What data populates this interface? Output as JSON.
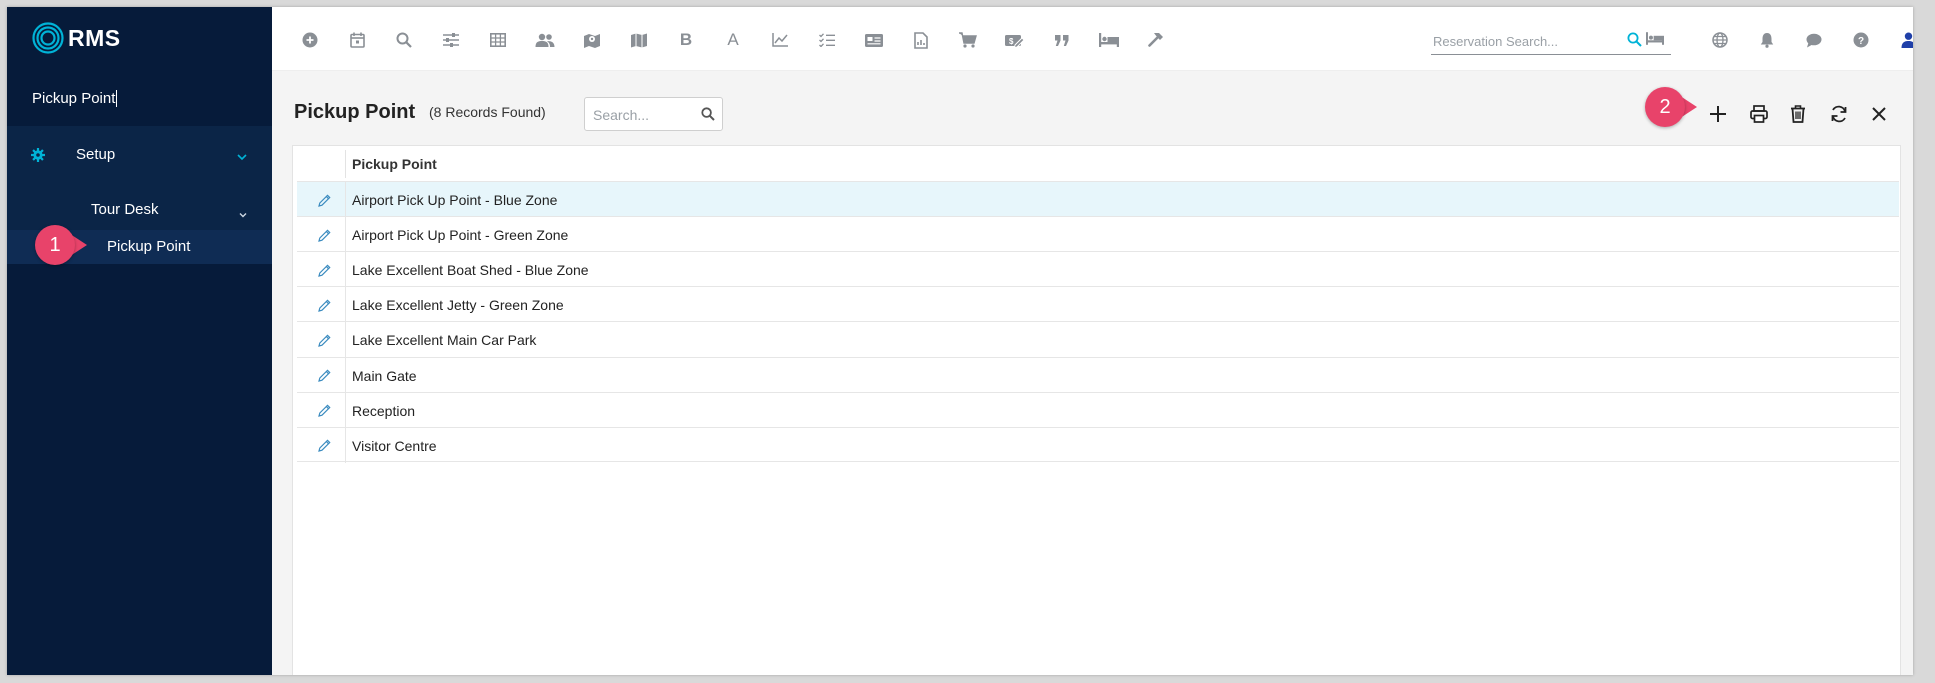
{
  "app": {
    "logo_text": "RMS"
  },
  "sidebar": {
    "search_value": "Pickup Point",
    "items": [
      {
        "label": "Setup",
        "icon": "gear-icon"
      },
      {
        "label": "Tour Desk"
      },
      {
        "label": "Pickup Point",
        "active": true
      }
    ]
  },
  "toolbar": {
    "icons": [
      "add-circle-icon",
      "calendar-icon",
      "search-icon",
      "sliders-icon",
      "grid-icon",
      "people-icon",
      "map-pin-icon",
      "map-icon",
      "bold-b-icon",
      "letter-a-icon",
      "line-chart-icon",
      "checklist-icon",
      "id-card-icon",
      "report-icon",
      "cart-icon",
      "voucher-icon",
      "quote-icon",
      "bed-icon",
      "hammer-icon"
    ],
    "bold_label": "B",
    "a_label": "A",
    "reservation_search_placeholder": "Reservation Search...",
    "right_icons": [
      "globe-icon",
      "bell-icon",
      "chat-icon",
      "help-icon",
      "user-icon"
    ]
  },
  "page": {
    "title": "Pickup Point",
    "records_found": "(8 Records Found)",
    "search_placeholder": "Search...",
    "actions": [
      "add",
      "print",
      "delete",
      "refresh",
      "close"
    ]
  },
  "table": {
    "column": "Pickup Point",
    "rows": [
      "Airport Pick Up Point - Blue Zone",
      "Airport Pick Up Point - Green Zone",
      "Lake Excellent Boat Shed - Blue Zone",
      "Lake Excellent Jetty - Green Zone",
      "Lake Excellent Main Car Park",
      "Main Gate",
      "Reception",
      "Visitor Centre"
    ],
    "selected_row": 0
  },
  "callouts": [
    "1",
    "2"
  ],
  "colors": {
    "sidebar_bg": "#061b3a",
    "accent": "#00b3d7",
    "callout": "#e8436a",
    "selected_row": "#e7f6fb",
    "user_icon": "#1f3fa8"
  }
}
